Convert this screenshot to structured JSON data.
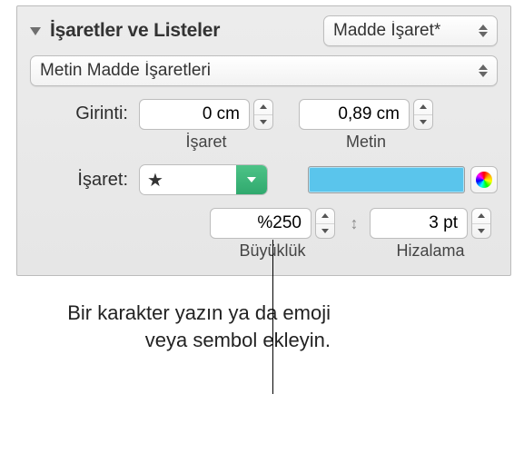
{
  "section_title": "İşaretler ve Listeler",
  "list_style": "Madde İşaret*",
  "bullet_type": "Metin Madde İşaretleri",
  "indent_label": "Girinti:",
  "indent_bullet": {
    "value": "0 cm",
    "caption": "İşaret"
  },
  "indent_text": {
    "value": "0,89 cm",
    "caption": "Metin"
  },
  "bullet_label": "İşaret:",
  "bullet_char": "★",
  "color": "#5ac5ec",
  "size": {
    "value": "%250",
    "caption": "Büyüklük"
  },
  "align": {
    "value": "3 pt",
    "caption": "Hizalama"
  },
  "callout": "Bir karakter yazın ya da emoji veya sembol ekleyin."
}
